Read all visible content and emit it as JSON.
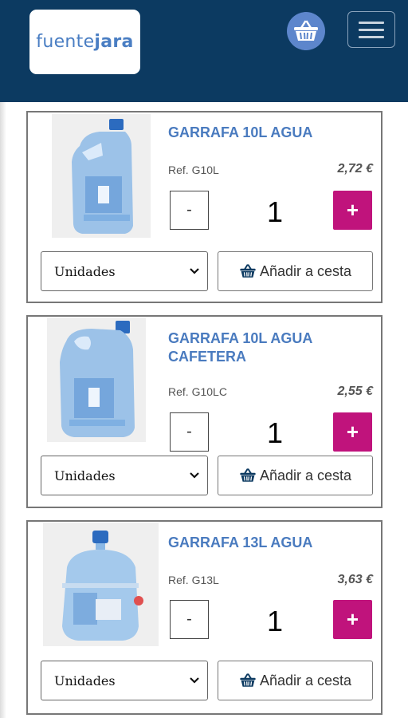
{
  "header": {
    "logo_part1": "fuente",
    "logo_part2": "jara"
  },
  "products": [
    {
      "title": "GARRAFA 10L AGUA",
      "ref": "Ref. G10L",
      "price": "2,72 €",
      "quantity": "1",
      "minus_label": "-",
      "plus_label": "+",
      "unit_selected": "Unidades",
      "add_label": "Añadir a cesta"
    },
    {
      "title": "GARRAFA 10L AGUA CAFETERA",
      "ref": "Ref. G10LC",
      "price": "2,55 €",
      "quantity": "1",
      "minus_label": "-",
      "plus_label": "+",
      "unit_selected": "Unidades",
      "add_label": "Añadir a cesta"
    },
    {
      "title": "GARRAFA 13L AGUA",
      "ref": "Ref. G13L",
      "price": "3,63 €",
      "quantity": "1",
      "minus_label": "-",
      "plus_label": "+",
      "unit_selected": "Unidades",
      "add_label": "Añadir a cesta"
    }
  ],
  "colors": {
    "header_bg": "#0c3a61",
    "brand_blue": "#4a7bbf",
    "accent_magenta": "#c0137c",
    "cart_circle": "#5d86cc"
  },
  "icons": [
    "basket-icon",
    "hamburger-icon",
    "chevron-down-icon"
  ]
}
